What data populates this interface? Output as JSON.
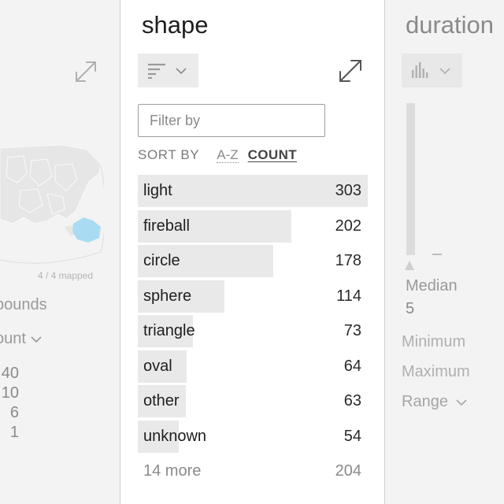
{
  "left_panel": {
    "map_caption": "4 / 4 mapped",
    "bounds_text": "bounds",
    "count_label": "ount",
    "values": [
      "40",
      "10",
      "6",
      "1"
    ],
    "colors": {
      "highlight": "#a9dcf3",
      "land": "#e6e6e6"
    }
  },
  "shape_panel": {
    "title": "shape",
    "filter": {
      "placeholder": "Filter by",
      "value": ""
    },
    "sort_by_label": "SORT BY",
    "sort_az_label": "A-Z",
    "sort_count_label": "COUNT",
    "max_count": 303,
    "rows": [
      {
        "label": "light",
        "count": 303
      },
      {
        "label": "fireball",
        "count": 202
      },
      {
        "label": "circle",
        "count": 178
      },
      {
        "label": "sphere",
        "count": 114
      },
      {
        "label": "triangle",
        "count": 73
      },
      {
        "label": "oval",
        "count": 64
      },
      {
        "label": "other",
        "count": 63
      },
      {
        "label": "unknown",
        "count": 54
      }
    ],
    "more": {
      "label": "14 more",
      "count": "204"
    }
  },
  "duration_panel": {
    "title": "duration",
    "median_label": "Median",
    "median_value": "5",
    "minimum_label": "Minimum",
    "maximum_label": "Maximum",
    "range_label": "Range"
  }
}
